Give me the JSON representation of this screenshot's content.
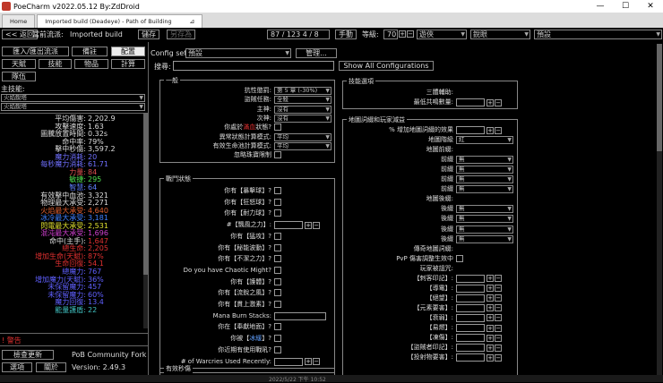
{
  "window": {
    "title": "PoeCharm v2022.05.12 By:ZdDroid"
  },
  "tabs": [
    {
      "label": "Home"
    },
    {
      "label": "Imported build (Deadeye) - Path of Building"
    }
  ],
  "toolbar": {
    "back": "<< 返回",
    "current_flow_label": "當前流派:",
    "current_flow_value": "Imported build",
    "save": "儲存",
    "save_as": "另存為",
    "points": "87 / 123   4 / 8",
    "manual": "手動",
    "level_label": "等級:",
    "level_value": "70",
    "class_value": "遊俠",
    "ascendancy_value": "銳眼",
    "mode_value": "預設"
  },
  "leftnav": {
    "import_export": "匯入/匯出流派",
    "notes": "備註",
    "config": "配置",
    "tree": "天賦",
    "skills": "技能",
    "items": "物品",
    "calcs": "計算",
    "party": "隊伍",
    "main_skill_label": "主技能:",
    "main_skill_value": "火焰銳塔",
    "sub_skill_value": "火焰銳塔"
  },
  "stats": [
    {
      "k": "平均傷害:",
      "v": "2,202.9",
      "c": "#dddddd"
    },
    {
      "k": "攻擊速度:",
      "v": "1.63",
      "c": "#dddddd"
    },
    {
      "k": "圖騰放置時間:",
      "v": "0.32s",
      "c": "#dddddd"
    },
    {
      "k": "命中率:",
      "v": "79%",
      "c": "#dddddd"
    },
    {
      "k": "擊中秒傷:",
      "v": "3,597.2",
      "c": "#dddddd"
    },
    {
      "k": "魔力消耗:",
      "v": "20",
      "c": "#7070ff"
    },
    {
      "k": "每秒魔力消耗:",
      "v": "61.71",
      "c": "#7070ff"
    },
    {
      "k": "力量:",
      "v": "84",
      "c": "#e05050"
    },
    {
      "k": "敏捷:",
      "v": "295",
      "c": "#50e050"
    },
    {
      "k": "智慧:",
      "v": "64",
      "c": "#6080ff"
    },
    {
      "k": "有效擊中血池:",
      "v": "3,321",
      "c": "#dddddd"
    },
    {
      "k": "物理最大承受:",
      "v": "2,271",
      "c": "#dddddd"
    },
    {
      "k": "火焰最大承受:",
      "v": "4,640",
      "c": "#e06030"
    },
    {
      "k": "冰冷最大承受:",
      "v": "3,181",
      "c": "#4080ff"
    },
    {
      "k": "閃電最大承受:",
      "v": "2,531",
      "c": "#e0e030"
    },
    {
      "k": "混沌最大承受:",
      "v": "1,696",
      "c": "#d040d0"
    },
    {
      "k": "命中(主手):",
      "v": "1,647",
      "c": "#dddddd",
      "vc": "#e03030"
    },
    {
      "k": "總生命:",
      "v": "2,205",
      "c": "#e03030"
    },
    {
      "k": "增加生命(天賦):",
      "v": "87%",
      "c": "#e03030"
    },
    {
      "k": "生命回復:",
      "v": "54.1",
      "c": "#e03030"
    },
    {
      "k": "總魔力:",
      "v": "767",
      "c": "#6060ff"
    },
    {
      "k": "增加魔力(天賦):",
      "v": "36%",
      "c": "#6060ff"
    },
    {
      "k": "未保留魔力:",
      "v": "457",
      "c": "#6060ff"
    },
    {
      "k": "未保留魔力:",
      "v": "60%",
      "c": "#6060ff"
    },
    {
      "k": "魔力回復:",
      "v": "13.4",
      "c": "#6060ff"
    },
    {
      "k": "能量護盾:",
      "v": "22",
      "c": "#40c0c0"
    }
  ],
  "bottomleft": {
    "warning": "! 警告",
    "check_update": "檢查更新",
    "pob_fork": "PoB Community Fork",
    "options": "選項",
    "about": "關於",
    "version": "Version: 2.49.3"
  },
  "config": {
    "set_label": "Config set:",
    "set_value": "預設",
    "manage": "管理...",
    "search_label": "搜尋:",
    "show_all": "Show All Configurations"
  },
  "general": {
    "title": "一般",
    "rows": [
      {
        "label": "抗性懲罰:",
        "type": "dd",
        "value": "第 5 章 (-30%)"
      },
      {
        "label": "盜賊任務:",
        "type": "dd",
        "value": "全殺"
      },
      {
        "label": "主神:",
        "type": "dd",
        "value": "沒有"
      },
      {
        "label": "次神:",
        "type": "dd",
        "value": "沒有"
      },
      {
        "label": "你處於",
        "label_hl": "滿血",
        "label_tail": "狀態?",
        "type": "cb"
      },
      {
        "label": "異常狀態計算模式:",
        "type": "dd",
        "value": "平均"
      },
      {
        "label": "有效生命池計算模式:",
        "type": "dd",
        "value": "平均"
      },
      {
        "label": "忽略珠寶限制",
        "type": "cb"
      }
    ]
  },
  "combat": {
    "title": "戰鬥狀態",
    "rows": [
      {
        "label": "你有【暴擊球】?",
        "type": "cb"
      },
      {
        "label": "你有【狂怒球】?",
        "type": "cb"
      },
      {
        "label": "你有【耐力球】?",
        "type": "cb"
      },
      {
        "label": "#【飄風之力】:",
        "type": "num"
      },
      {
        "label": "你有【猛攻】?",
        "type": "cb"
      },
      {
        "label": "你有【秘能波動】?",
        "type": "cb"
      },
      {
        "label": "你有【不潔之力】?",
        "type": "cb"
      },
      {
        "label": "Do you have Chaotic Might?",
        "type": "cb"
      },
      {
        "label": "你有【護體】?",
        "type": "cb"
      },
      {
        "label": "你有【流銳之風】?",
        "type": "cb"
      },
      {
        "label": "你有【貫上激素】?",
        "type": "cb"
      },
      {
        "label": "Mana Burn Stacks:",
        "type": "inp"
      },
      {
        "label": "你在【奉獻地面】?",
        "type": "cb"
      },
      {
        "label": "你被【",
        "label_hl": "冰緩",
        "label_tail": "】?",
        "type": "cb"
      },
      {
        "label": "你近期有使用戰吼?",
        "type": "cb"
      },
      {
        "label": "# of Warcries Used Recently:",
        "type": "num"
      }
    ]
  },
  "effective_dps": {
    "title": "有效秒傷"
  },
  "skill_options": {
    "title": "技能選項",
    "rows": [
      {
        "label": "三體輔助:"
      },
      {
        "label": "最低共鳴數量:",
        "type": "num"
      }
    ]
  },
  "map_mods": {
    "title": "地圖詞綴和玩家減益",
    "rows": [
      {
        "label": "% 增加地圖詞綴的效果",
        "type": "num"
      },
      {
        "label": "地圖階級",
        "type": "dd",
        "value": "紅"
      },
      {
        "label": "地圖前綴:",
        "type": "none"
      },
      {
        "label": "前綴",
        "type": "dd",
        "value": "無"
      },
      {
        "label": "前綴",
        "type": "dd",
        "value": "無"
      },
      {
        "label": "前綴",
        "type": "dd",
        "value": "無"
      },
      {
        "label": "前綴",
        "type": "dd",
        "value": "無"
      },
      {
        "label": "地圖後綴:",
        "type": "none"
      },
      {
        "label": "後綴",
        "type": "dd",
        "value": "無"
      },
      {
        "label": "後綴",
        "type": "dd",
        "value": "無"
      },
      {
        "label": "後綴",
        "type": "dd",
        "value": "無"
      },
      {
        "label": "後綴",
        "type": "dd",
        "value": "無"
      },
      {
        "label": "傳奇地圖詞綴:",
        "type": "none"
      },
      {
        "label": "PvP 傷害調整生效中",
        "type": "cb"
      },
      {
        "label": "玩家被詛咒:",
        "type": "none"
      },
      {
        "label": "【刺客印記】:",
        "type": "num"
      },
      {
        "label": "【導電】:",
        "type": "num"
      },
      {
        "label": "【絕望】:",
        "type": "num"
      },
      {
        "label": "【元素要害】:",
        "type": "num"
      },
      {
        "label": "【衰弱】:",
        "type": "num"
      },
      {
        "label": "【易燃】:",
        "type": "num"
      },
      {
        "label": "【凍傷】:",
        "type": "num"
      },
      {
        "label": "【盜賊者印記】:",
        "type": "num"
      },
      {
        "label": "【投射物要害】:",
        "type": "num"
      }
    ]
  },
  "taskbar": {
    "time": "2022/5/22  下午 10:52"
  }
}
